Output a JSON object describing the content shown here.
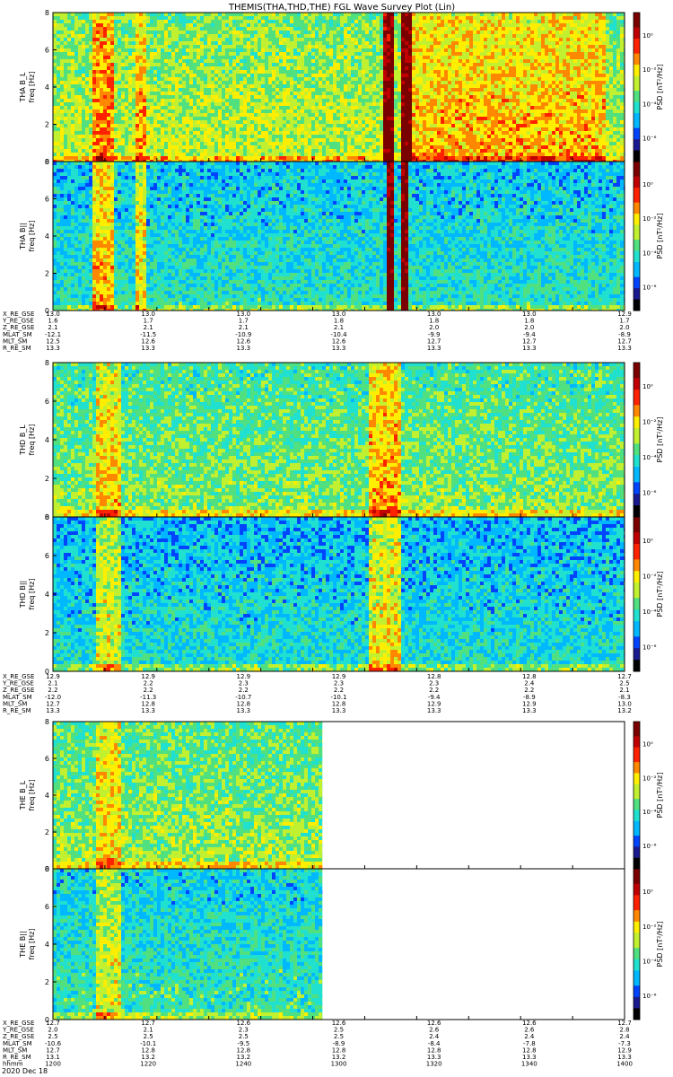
{
  "title": "THEMIS(THA,THD,THE) FGL Wave Survey Plot (Lin)",
  "date": "2020 Dec 18",
  "colors": {
    "frame": "#000000",
    "colormap": [
      "#7a0000",
      "#c00000",
      "#ff2200",
      "#ff8800",
      "#ffee00",
      "#c0f030",
      "#50e080",
      "#20e0d0",
      "#00b8ff",
      "#0044ff",
      "#1a1a90",
      "#000000"
    ]
  },
  "chart_data": [
    {
      "type": "heatmap",
      "panel": "THA B_L",
      "ylabel": "THA B_L\nfreq [Hz]",
      "ylim": [
        0,
        8
      ],
      "yticks": [
        "0",
        "2",
        "4",
        "6",
        "8"
      ],
      "colorbar": {
        "label": "PSD [nT²/Hz]",
        "ticks": [
          "10⁰",
          "10⁻²",
          "10⁻⁴",
          "10⁻⁶"
        ]
      },
      "x_hhmm": [
        1200,
        1420
      ],
      "data_extent": [
        1200,
        1420
      ],
      "base_level": 0.48,
      "features": [
        {
          "x": 1212,
          "width": 2.5,
          "level": 0.66
        },
        {
          "x": 1221,
          "width": 1.0,
          "level": 0.62
        },
        {
          "x": 1322,
          "width": 1.2,
          "level": 0.92
        },
        {
          "x": 1326,
          "width": 1.2,
          "level": 0.95
        },
        {
          "x": 1350,
          "width": 25,
          "level": 0.6
        }
      ]
    },
    {
      "type": "heatmap",
      "panel": "THA B||",
      "ylabel": "THA B||\nfreq [Hz]",
      "ylim": [
        0,
        8
      ],
      "yticks": [
        "0",
        "2",
        "4",
        "6",
        "8"
      ],
      "colorbar": {
        "label": "PSD [nT²/Hz]",
        "ticks": [
          "10⁰",
          "10⁻²",
          "10⁻⁴",
          "10⁻⁶"
        ]
      },
      "x_hhmm": [
        1200,
        1420
      ],
      "data_extent": [
        1200,
        1420
      ],
      "base_level": 0.32,
      "features": [
        {
          "x": 1212,
          "width": 2.5,
          "level": 0.6
        },
        {
          "x": 1221,
          "width": 1.0,
          "level": 0.55
        },
        {
          "x": 1322,
          "width": 1.0,
          "level": 0.95
        },
        {
          "x": 1326,
          "width": 1.0,
          "level": 0.95
        }
      ]
    },
    {
      "type": "heatmap",
      "panel": "THD B_L",
      "ylabel": "THD B_L\nfreq [Hz]",
      "ylim": [
        0,
        8
      ],
      "yticks": [
        "0",
        "2",
        "4",
        "6",
        "8"
      ],
      "colorbar": {
        "label": "PSD [nT²/Hz]",
        "ticks": [
          "10⁰",
          "10⁻²",
          "10⁻⁴",
          "10⁻⁶"
        ]
      },
      "x_hhmm": [
        1200,
        1420
      ],
      "data_extent": [
        1200,
        1420
      ],
      "base_level": 0.42,
      "features": [
        {
          "x": 1213,
          "width": 3,
          "level": 0.58
        },
        {
          "x": 1321,
          "width": 4,
          "level": 0.62
        }
      ]
    },
    {
      "type": "heatmap",
      "panel": "THD B||",
      "ylabel": "THD B||\nfreq [Hz]",
      "ylim": [
        0,
        8
      ],
      "yticks": [
        "0",
        "2",
        "4",
        "6",
        "8"
      ],
      "colorbar": {
        "label": "PSD [nT²/Hz]",
        "ticks": [
          "10⁰",
          "10⁻²",
          "10⁻⁴",
          "10⁻⁶"
        ]
      },
      "x_hhmm": [
        1200,
        1420
      ],
      "data_extent": [
        1200,
        1420
      ],
      "base_level": 0.3,
      "features": [
        {
          "x": 1213,
          "width": 3,
          "level": 0.52
        },
        {
          "x": 1321,
          "width": 4,
          "level": 0.55
        }
      ]
    },
    {
      "type": "heatmap",
      "panel": "THE B_L",
      "ylabel": "THE B_L\nfreq [Hz]",
      "ylim": [
        0,
        8
      ],
      "yticks": [
        "0",
        "2",
        "4",
        "6",
        "8"
      ],
      "colorbar": {
        "label": "PSD [nT²/Hz]",
        "ticks": [
          "10⁰",
          "10⁻²",
          "10⁻⁴",
          "10⁻⁶"
        ]
      },
      "x_hhmm": [
        1200,
        1420
      ],
      "data_extent": [
        1200,
        1306
      ],
      "base_level": 0.44,
      "features": [
        {
          "x": 1213,
          "width": 3,
          "level": 0.58
        }
      ]
    },
    {
      "type": "heatmap",
      "panel": "THE B||",
      "ylabel": "THE B||\nfreq [Hz]",
      "ylim": [
        0,
        8
      ],
      "yticks": [
        "0",
        "2",
        "4",
        "6",
        "8"
      ],
      "colorbar": {
        "label": "PSD [nT²/Hz]",
        "ticks": [
          "10⁰",
          "10⁻²",
          "10⁻⁴",
          "10⁻⁶"
        ]
      },
      "x_hhmm": [
        1200,
        1420
      ],
      "data_extent": [
        1200,
        1306
      ],
      "base_level": 0.34,
      "features": [
        {
          "x": 1213,
          "width": 3,
          "level": 0.52
        }
      ]
    }
  ],
  "ephemeris": [
    {
      "rows": [
        {
          "label": "X_RE_GSE",
          "values": [
            "13.0",
            "13.0",
            "13.0",
            "13.0",
            "13.0",
            "13.0",
            "12.9"
          ]
        },
        {
          "label": "Y_RE_GSE",
          "values": [
            "1.6",
            "1.7",
            "1.7",
            "1.8",
            "1.8",
            "1.8",
            "1.7"
          ]
        },
        {
          "label": "Z_RE_GSE",
          "values": [
            "2.1",
            "2.1",
            "2.1",
            "2.1",
            "2.0",
            "2.0",
            "2.0"
          ]
        },
        {
          "label": "MLAT_SM",
          "values": [
            "-12.1",
            "-11.5",
            "-10.9",
            "-10.4",
            "-9.9",
            "-9.4",
            "-8.9"
          ]
        },
        {
          "label": "MLT_SM",
          "values": [
            "12.5",
            "12.6",
            "12.6",
            "12.6",
            "12.7",
            "12.7",
            "12.7"
          ]
        },
        {
          "label": "R_RE_SM",
          "values": [
            "13.3",
            "13.3",
            "13.3",
            "13.3",
            "13.3",
            "13.3",
            "13.3"
          ]
        }
      ]
    },
    {
      "rows": [
        {
          "label": "X_RE_GSE",
          "values": [
            "12.9",
            "12.9",
            "12.9",
            "12.9",
            "12.8",
            "12.8",
            "12.7"
          ]
        },
        {
          "label": "Y_RE_GSE",
          "values": [
            "2.1",
            "2.2",
            "2.3",
            "2.3",
            "2.3",
            "2.4",
            "2.5"
          ]
        },
        {
          "label": "Z_RE_GSE",
          "values": [
            "2.2",
            "2.2",
            "2.2",
            "2.2",
            "2.2",
            "2.2",
            "2.1"
          ]
        },
        {
          "label": "MLAT_SM",
          "values": [
            "-12.0",
            "-11.3",
            "-10.7",
            "-10.1",
            "-9.4",
            "-8.9",
            "-8.3"
          ]
        },
        {
          "label": "MLT_SM",
          "values": [
            "12.7",
            "12.8",
            "12.8",
            "12.8",
            "12.9",
            "12.9",
            "13.0"
          ]
        },
        {
          "label": "R_RE_SM",
          "values": [
            "13.3",
            "13.3",
            "13.3",
            "13.3",
            "13.3",
            "13.3",
            "13.2"
          ]
        }
      ]
    },
    {
      "rows": [
        {
          "label": "X_RE_GSE",
          "values": [
            "12.7",
            "12.7",
            "12.6",
            "12.6",
            "12.6",
            "12.6",
            "12.7"
          ]
        },
        {
          "label": "Y_RE_GSE",
          "values": [
            "2.0",
            "2.1",
            "2.3",
            "2.5",
            "2.6",
            "2.6",
            "2.8"
          ]
        },
        {
          "label": "Z_RE_GSE",
          "values": [
            "2.5",
            "2.5",
            "2.5",
            "2.5",
            "2.4",
            "2.4",
            "2.4"
          ]
        },
        {
          "label": "MLAT_SM",
          "values": [
            "-10.6",
            "-10.1",
            "-9.5",
            "-8.9",
            "-8.4",
            "-7.8",
            "-7.3"
          ]
        },
        {
          "label": "MLT_SM",
          "values": [
            "12.7",
            "12.8",
            "12.8",
            "12.8",
            "12.8",
            "12.8",
            "12.9"
          ]
        },
        {
          "label": "R_RE_SM",
          "values": [
            "13.1",
            "13.2",
            "13.2",
            "13.2",
            "13.3",
            "13.3",
            "13.3"
          ]
        },
        {
          "label": "hhmm",
          "values": [
            "1200",
            "1220",
            "1240",
            "1300",
            "1320",
            "1340",
            "1400"
          ]
        }
      ]
    }
  ]
}
